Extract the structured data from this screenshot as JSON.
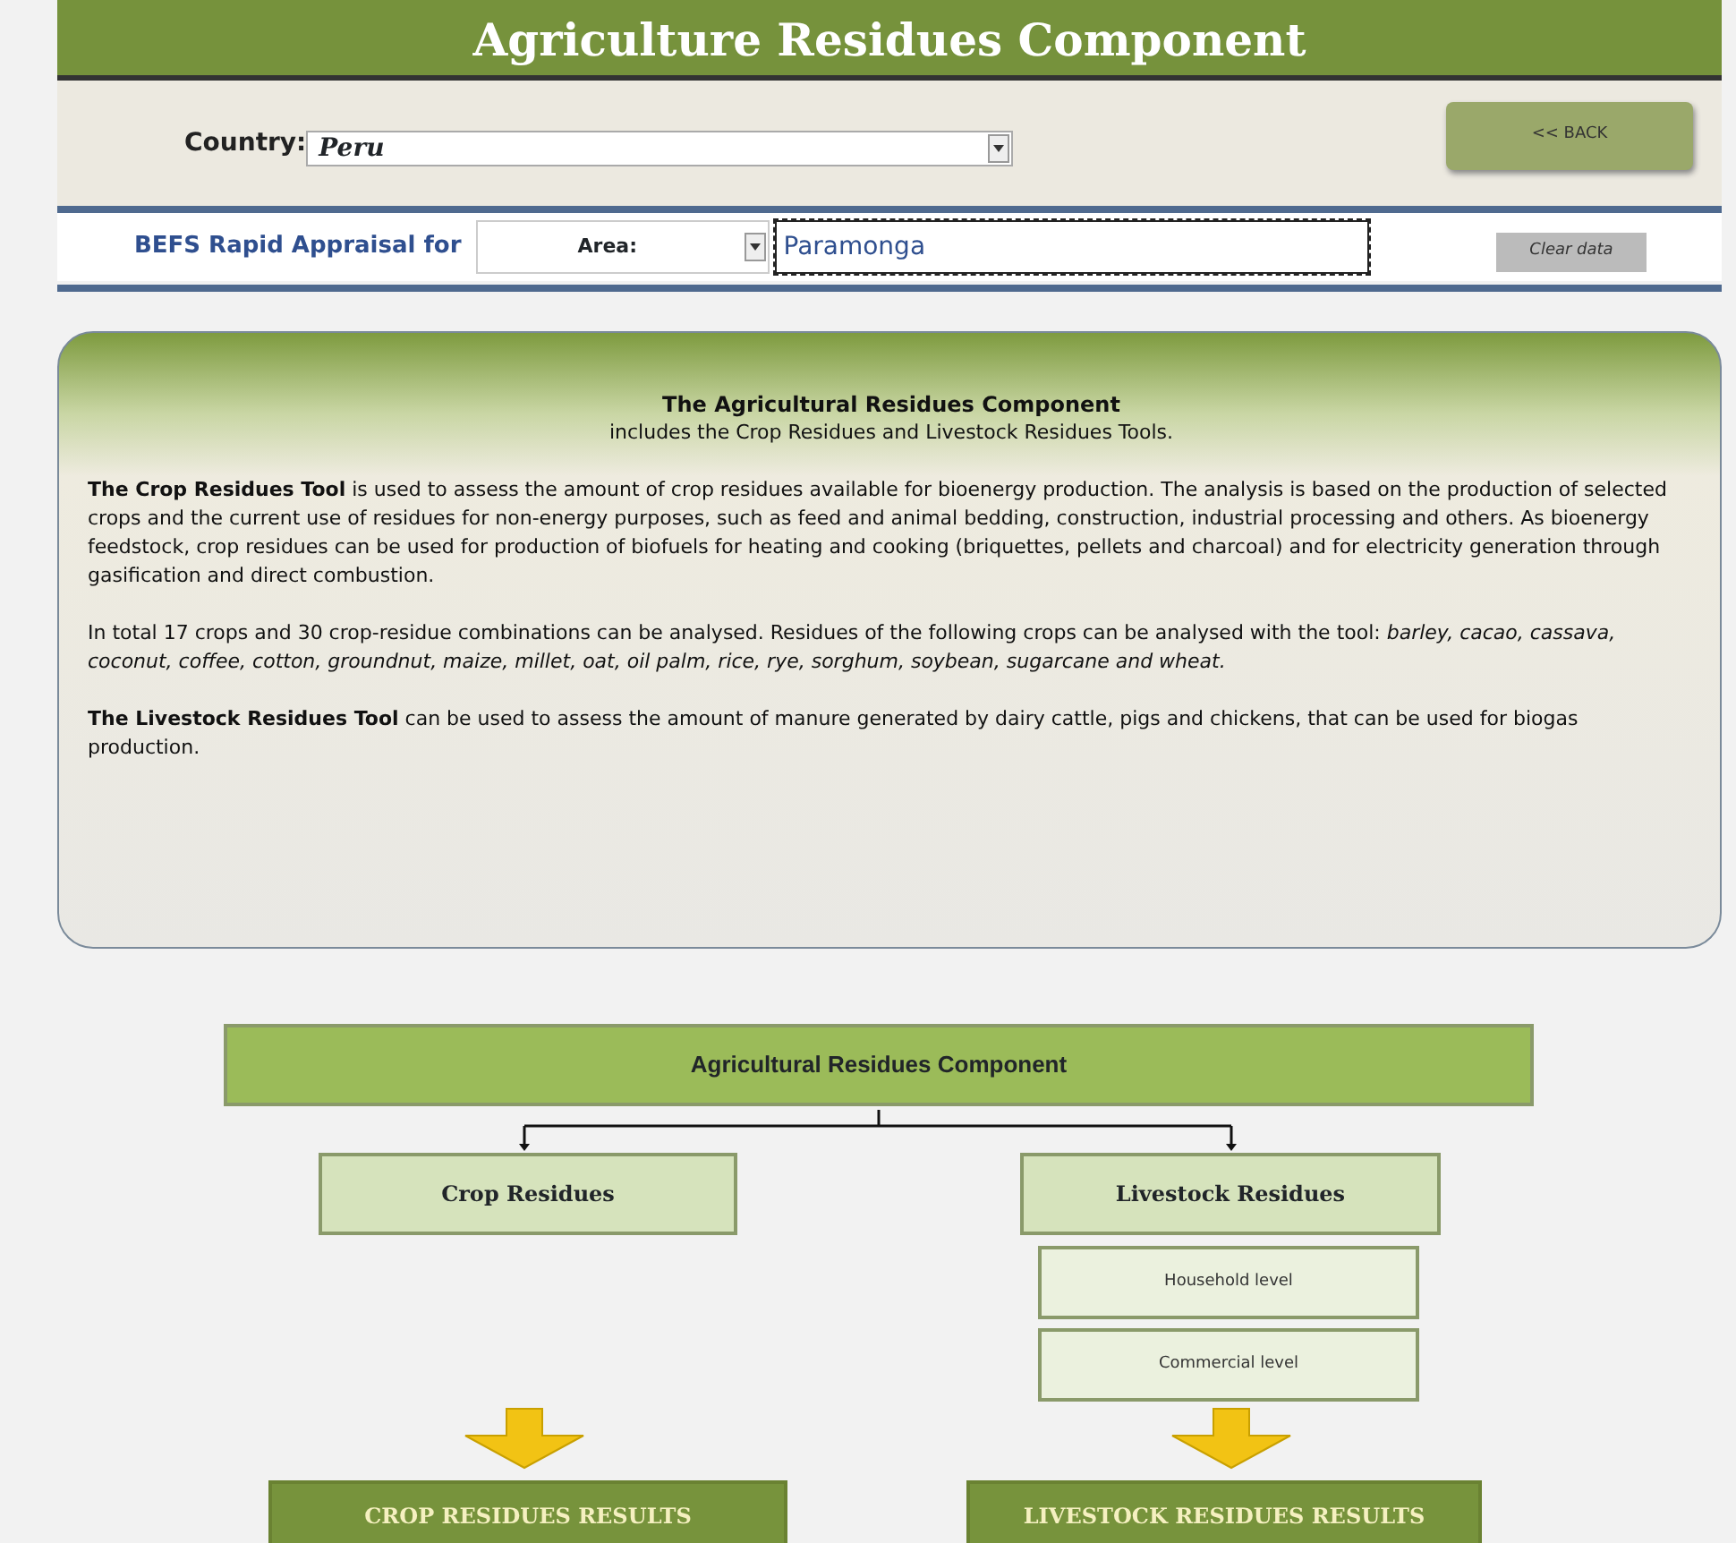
{
  "header": {
    "title": "Agriculture Residues Component"
  },
  "country": {
    "label": "Country:",
    "value": "Peru"
  },
  "back_button": "<< BACK",
  "appraisal": {
    "label": "BEFS Rapid Appraisal for",
    "area_select": "Area:",
    "location": "Paramonga"
  },
  "clear_button": "Clear data",
  "info": {
    "title": "The Agricultural Residues Component",
    "subtitle": "includes the Crop Residues and Livestock Residues Tools.",
    "paragraphs": [
      "**The Crop Residues Tool** is used to assess the amount of crop residues available for bioenergy production.  The analysis is based on the production of selected crops and the current use of residues for non-energy purposes, such as feed and animal bedding, construction, industrial processing and others. As bioenergy feedstock, crop residues can be used for production of biofuels for heating and cooking (briquettes, pellets and charcoal) and for electricity generation through gasification and direct combustion.",
      "In total 17 crops and 30 crop-residue combinations  can be analysed. Residues of the following crops can be analysed with the tool: *barley, cacao, cassava, coconut, coffee, cotton, groundnut, maize, millet, oat, oil palm, rice, rye, sorghum, soybean, sugarcane and wheat.*",
      "**The Livestock Residues Tool** can be used to assess the amount of manure generated by dairy cattle, pigs and chickens, that can be used for biogas production."
    ]
  },
  "diagram": {
    "root": "Agricultural Residues Component",
    "branches": [
      {
        "label": "Crop Residues",
        "result": "CROP RESIDUES RESULTS"
      },
      {
        "label": "Livestock Residues",
        "children": [
          "Household level",
          "Commercial level"
        ],
        "result": "LIVESTOCK RESIDUES RESULTS"
      }
    ]
  }
}
